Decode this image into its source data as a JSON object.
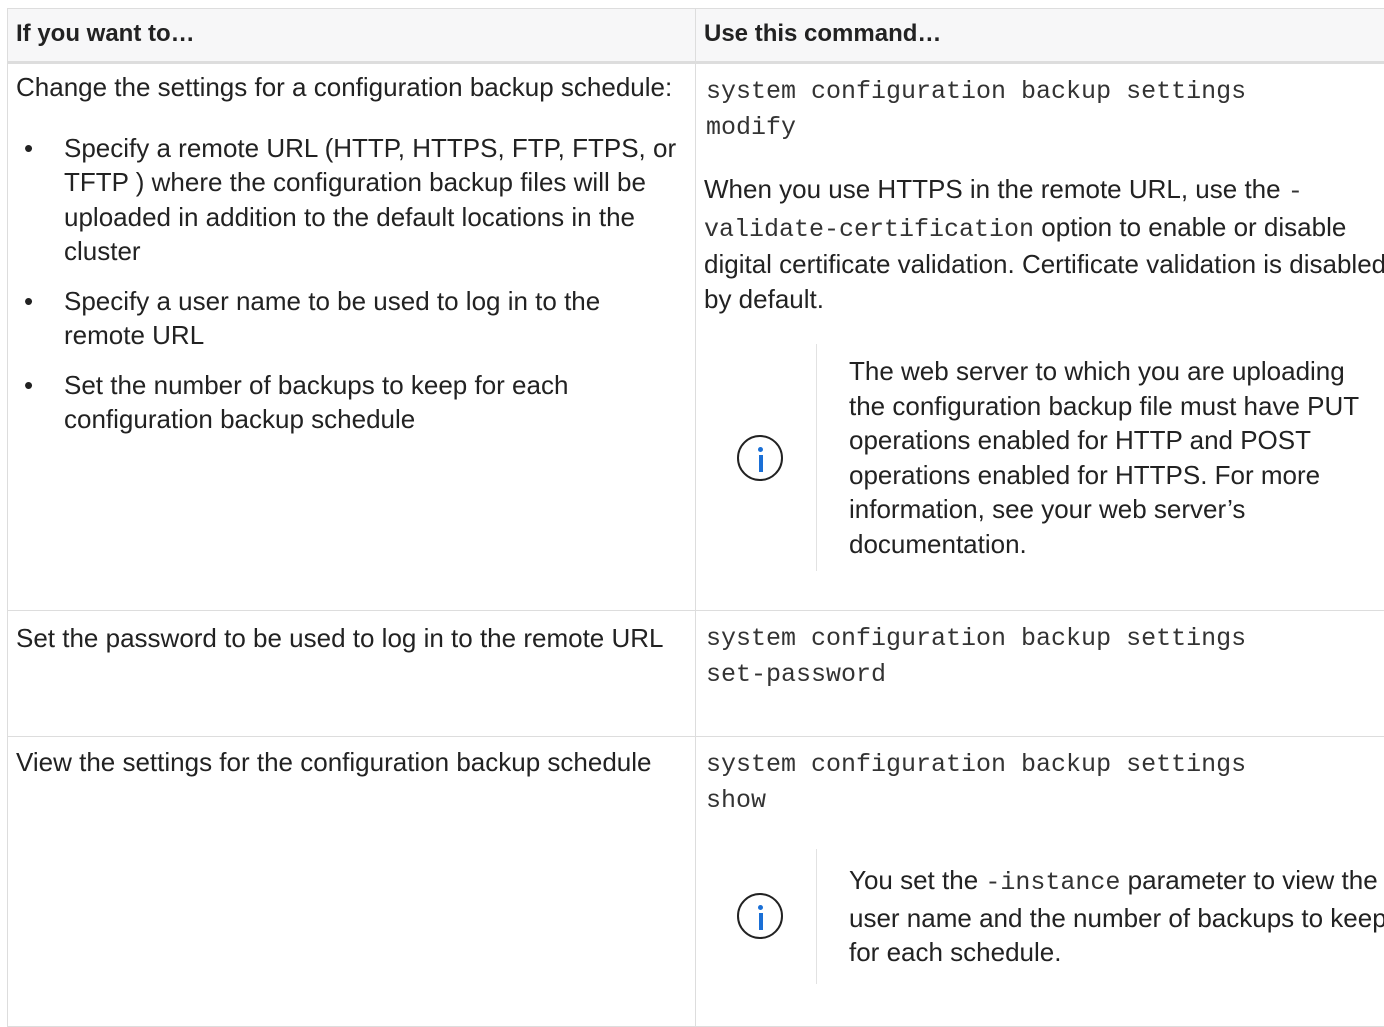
{
  "table": {
    "headers": [
      "If you want to…",
      "Use this command…"
    ],
    "rows": [
      {
        "want": "Change the settings for a configuration backup schedule:",
        "bullets": [
          "Specify a remote URL (HTTP, HTTPS, FTP, FTPS, or TFTP ) where the configuration backup files will be uploaded in addition to the default locations in the cluster",
          "Specify a user name to be used to log in to the remote URL",
          "Set the number of backups to keep for each configuration backup schedule"
        ],
        "command": "system configuration backup settings\nmodify",
        "para_before": "When you use HTTPS in the remote URL, use the",
        "para_code": "-validate-certification",
        "para_after": "option to enable or disable digital certificate validation. Certificate validation is disabled by default.",
        "note": "The web server to which you are uploading the configuration backup file must have PUT operations enabled for HTTP and POST operations enabled for HTTPS. For more information, see your web server’s documentation.",
        "note_icon": "info-icon"
      },
      {
        "want": "Set the password to be used to log in to the remote URL",
        "command": "system configuration backup settings\nset-password"
      },
      {
        "want": "View the settings for the configuration backup schedule",
        "command": "system configuration backup settings\nshow",
        "note_before": "You set the",
        "note_code": "-instance",
        "note_after": "parameter to view the user name and the number of backups to keep for each schedule.",
        "note_icon": "info-icon"
      }
    ]
  },
  "colors": {
    "border": "#dddddd",
    "header_bg": "#f7f7f8",
    "icon_accent": "#1a6fd6"
  }
}
